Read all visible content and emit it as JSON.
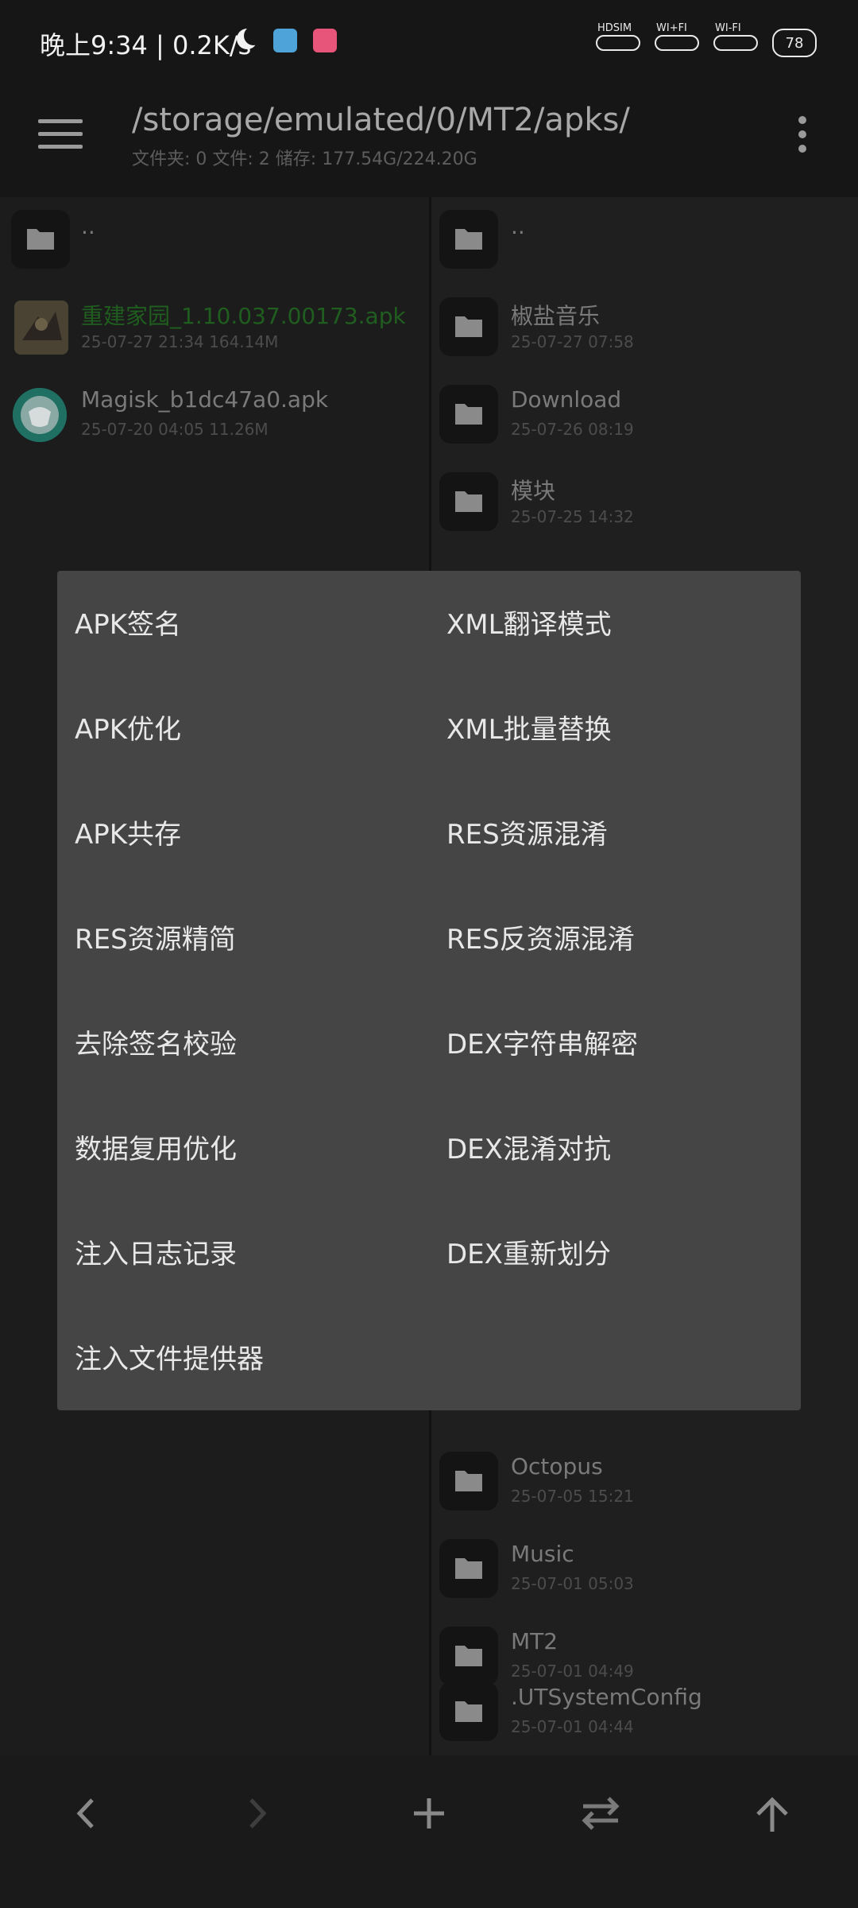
{
  "status_bar": {
    "time": "晚上9:34 | 0.2K/s",
    "sim1_label": "HDSIM",
    "sim2_label": "WI+FI",
    "wifi_label": "WI-FI",
    "battery": "78"
  },
  "toolbar": {
    "path": "/storage/emulated/0/MT2/apks/",
    "info": "文件夹: 0  文件: 2  储存: 177.54G/224.20G"
  },
  "left_pane": {
    "parent_label": "..",
    "files": [
      {
        "name": "重建家园_1.10.037.00173.apk",
        "meta": "25-07-27 21:34  164.14M"
      },
      {
        "name": "Magisk_b1dc47a0.apk",
        "meta": "25-07-20 04:05  11.26M"
      }
    ]
  },
  "right_pane": {
    "parent_label": "..",
    "top_items": [
      {
        "name": "椒盐音乐",
        "meta": "25-07-27 07:58"
      },
      {
        "name": "Download",
        "meta": "25-07-26 08:19"
      },
      {
        "name": "模块",
        "meta": "25-07-25 14:32"
      }
    ],
    "bottom_items": [
      {
        "name": "Octopus",
        "meta": "25-07-05 15:21"
      },
      {
        "name": "Music",
        "meta": "25-07-01 05:03"
      },
      {
        "name": "MT2",
        "meta": "25-07-01 04:49"
      },
      {
        "name": ".UTSystemConfig",
        "meta": "25-07-01 04:44"
      }
    ]
  },
  "dialog": {
    "left": [
      "APK签名",
      "APK优化",
      "APK共存",
      "RES资源精简",
      "去除签名校验",
      "数据复用优化",
      "注入日志记录",
      "注入文件提供器"
    ],
    "right": [
      "XML翻译模式",
      "XML批量替换",
      "RES资源混淆",
      "RES反资源混淆",
      "DEX字符串解密",
      "DEX混淆对抗",
      "DEX重新划分"
    ]
  },
  "colors": {
    "background": "#1c1c1c",
    "dialog": "#454545",
    "apk_green": "#1f5e1f"
  },
  "icons": [
    "menu-icon",
    "more-vert-icon",
    "folder-icon",
    "back-icon",
    "forward-icon",
    "add-icon",
    "swap-icon",
    "up-icon"
  ]
}
